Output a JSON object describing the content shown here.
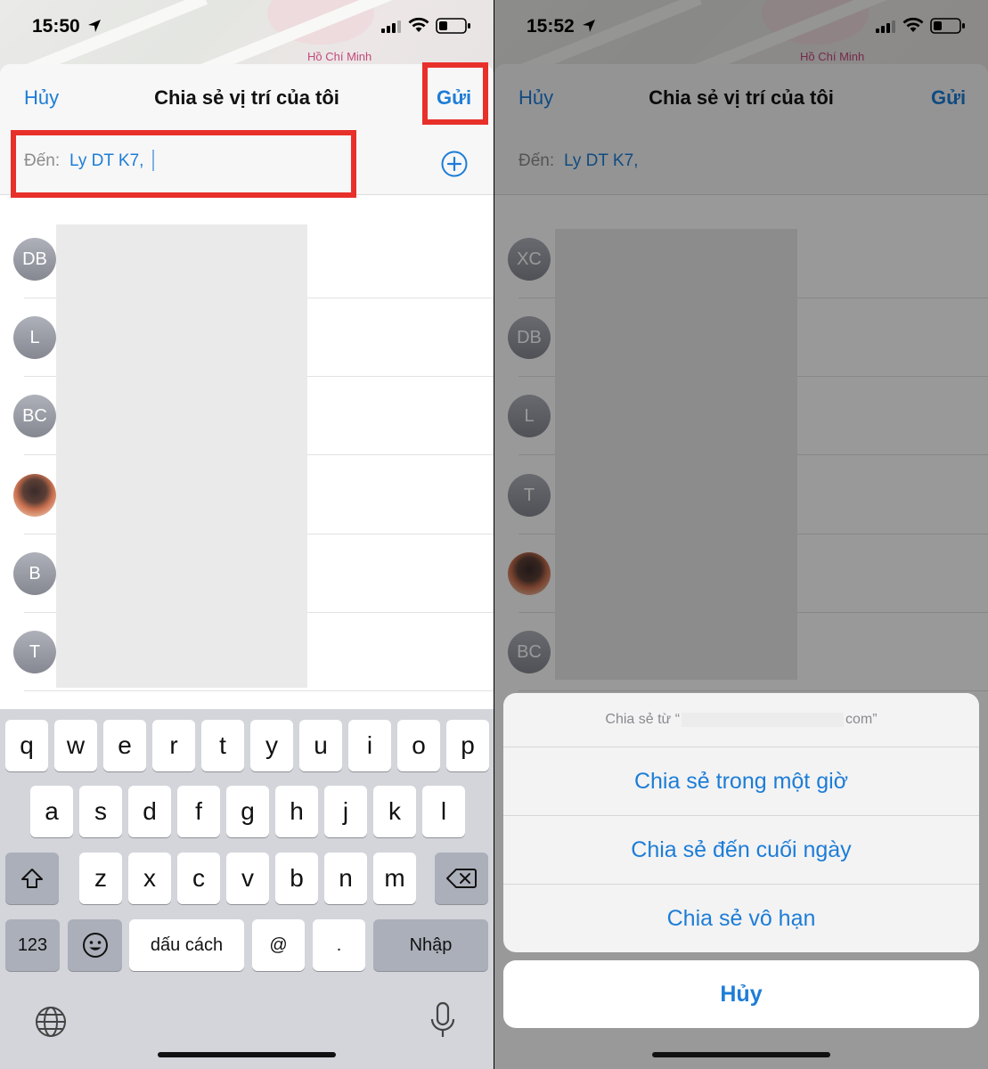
{
  "accent_color": "#1d7dd6",
  "highlight_color": "#e8302a",
  "left": {
    "status": {
      "time": "15:50"
    },
    "map_label": "Hồ Chí Minh",
    "nav": {
      "cancel": "Hủy",
      "title": "Chia sẻ vị trí của tôi",
      "send": "Gửi"
    },
    "to": {
      "label": "Đến:",
      "value": "Ly DT K7,"
    },
    "contacts": [
      {
        "initials": "DB"
      },
      {
        "initials": "L"
      },
      {
        "initials": "BC"
      },
      {
        "initials": "",
        "photo": true
      },
      {
        "initials": "B"
      },
      {
        "initials": "T"
      }
    ],
    "keyboard": {
      "row1": [
        "q",
        "w",
        "e",
        "r",
        "t",
        "y",
        "u",
        "i",
        "o",
        "p"
      ],
      "row2": [
        "a",
        "s",
        "d",
        "f",
        "g",
        "h",
        "j",
        "k",
        "l"
      ],
      "row3": [
        "z",
        "x",
        "c",
        "v",
        "b",
        "n",
        "m"
      ],
      "numbers": "123",
      "space": "dấu cách",
      "at": "@",
      "dot": ".",
      "return": "Nhập"
    }
  },
  "right": {
    "status": {
      "time": "15:52"
    },
    "map_label": "Hồ Chí Minh",
    "nav": {
      "cancel": "Hủy",
      "title": "Chia sẻ vị trí của tôi",
      "send": "Gửi"
    },
    "to": {
      "label": "Đến:",
      "value": "Ly DT K7,"
    },
    "contacts": [
      {
        "initials": "XC"
      },
      {
        "initials": "DB"
      },
      {
        "initials": "L"
      },
      {
        "initials": "T"
      },
      {
        "initials": "",
        "photo": true
      },
      {
        "initials": "BC"
      }
    ],
    "action_sheet": {
      "header_prefix": "Chia sẻ từ “",
      "header_suffix": "com”",
      "options": [
        "Chia sẻ trong một giờ",
        "Chia sẻ đến cuối ngày",
        "Chia sẻ vô hạn"
      ],
      "cancel": "Hủy"
    }
  }
}
